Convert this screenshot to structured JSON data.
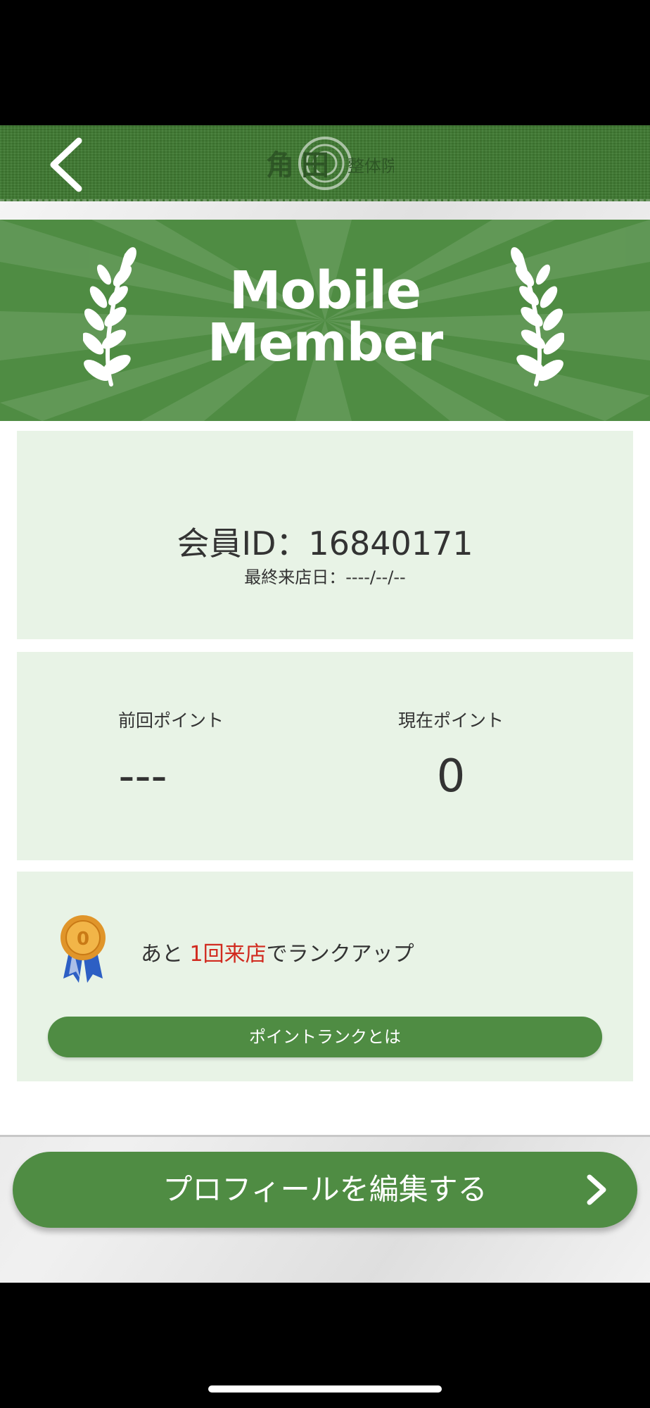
{
  "header": {
    "back_icon": "chevron-left-icon",
    "logo_text": "角田"
  },
  "banner": {
    "title_line1": "Mobile",
    "title_line2": "Member"
  },
  "member_card": {
    "member_id": "会員ID：16840171",
    "last_visit": "最終来店日：----/--/--"
  },
  "points": {
    "previous_label": "前回ポイント",
    "previous_value": "---",
    "current_label": "現在ポイント",
    "current_value": "0"
  },
  "rank": {
    "prefix": "あと ",
    "count": "1回来店",
    "suffix": "でランクアップ",
    "accent_color": "#d12a1f",
    "button_label": "ポイントランクとは"
  },
  "footer": {
    "edit_profile_label": "プロフィールを編集する"
  },
  "colors": {
    "brand_green": "#4f8c43",
    "card_bg": "#e8f3e6"
  }
}
